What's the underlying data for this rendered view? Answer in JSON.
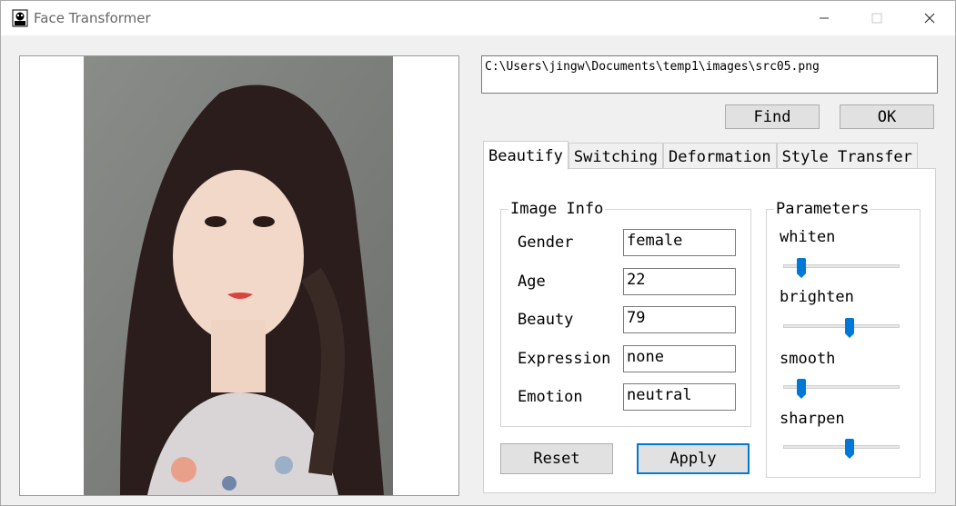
{
  "window": {
    "title": "Face Transformer"
  },
  "file": {
    "path": "C:\\Users\\jingw\\Documents\\temp1\\images\\src05.png"
  },
  "buttons": {
    "find": "Find",
    "ok": "OK",
    "reset": "Reset",
    "apply": "Apply"
  },
  "tabs": [
    {
      "label": "Beautify",
      "active": true
    },
    {
      "label": "Switching",
      "active": false
    },
    {
      "label": "Deformation",
      "active": false
    },
    {
      "label": "Style Transfer",
      "active": false
    }
  ],
  "image_info": {
    "title": "Image Info",
    "fields": [
      {
        "label": "Gender",
        "value": "female"
      },
      {
        "label": "Age",
        "value": "22"
      },
      {
        "label": "Beauty",
        "value": "79"
      },
      {
        "label": "Expression",
        "value": "none"
      },
      {
        "label": "Emotion",
        "value": "neutral"
      }
    ]
  },
  "parameters": {
    "title": "Parameters",
    "sliders": [
      {
        "label": "whiten",
        "value": 0.12
      },
      {
        "label": "brighten",
        "value": 0.58
      },
      {
        "label": "smooth",
        "value": 0.12
      },
      {
        "label": "sharpen",
        "value": 0.58
      }
    ]
  },
  "colors": {
    "accent": "#0078d7"
  }
}
